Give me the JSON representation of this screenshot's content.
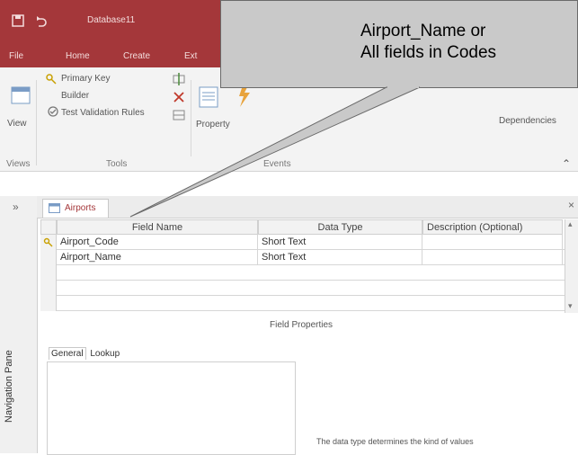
{
  "window": {
    "title": "Database11",
    "tabs": [
      "File",
      "Home",
      "Create",
      "Ext"
    ]
  },
  "ribbon": {
    "view_label": "View",
    "primary_key": "Primary Key",
    "builder": "Builder",
    "test_validation": "Test Validation Rules",
    "tools_group": "Tools",
    "views_group": "Views",
    "property_sheet": "Property",
    "dependencies": "Dependencies",
    "events_group": "Events"
  },
  "document": {
    "tab_label": "Airports",
    "field_properties_label": "Field Properties",
    "property_tabs": [
      "General",
      "Lookup"
    ],
    "help_text": "The data type determines the kind of values"
  },
  "grid": {
    "columns": [
      "Field Name",
      "Data Type",
      "Description (Optional)"
    ],
    "rows": [
      {
        "field": "Airport_Code",
        "type": "Short Text",
        "primary_key": true
      },
      {
        "field": "Airport_Name",
        "type": "Short Text",
        "primary_key": false
      }
    ]
  },
  "nav_pane": {
    "label": "Navigation Pane"
  },
  "callout": {
    "lines": [
      "Airport_Name or",
      "All fields in Codes"
    ]
  },
  "colors": {
    "accent": "#a4373a",
    "callout": "#c9c9c9"
  }
}
